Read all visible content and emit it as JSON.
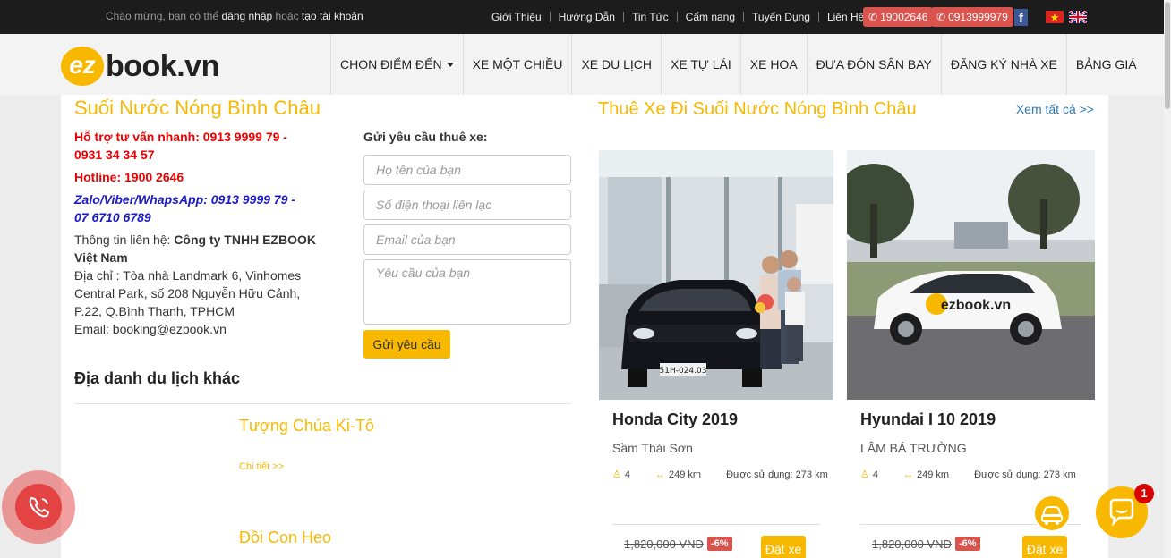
{
  "topbar": {
    "welcome_prefix": "Chào mừng, bạn có thể",
    "login": "đăng nhập",
    "or": "hoặc",
    "register": "tạo tài khoản",
    "links": [
      "Giới Thiệu",
      "Hướng Dẫn",
      "Tin Tức",
      "Cẩm nang",
      "Tuyển Dụng",
      "Liên Hệ"
    ],
    "phone1": "19002646",
    "phone2": "0913999979",
    "accent": "#d9534f"
  },
  "nav": {
    "logo_ez": "ez",
    "logo_book": "book.vn",
    "items": [
      "CHỌN ĐIỂM ĐẾN",
      "XE MỘT CHIỀU",
      "XE DU LỊCH",
      "XE TỰ LÁI",
      "XE HOA",
      "ĐƯA ĐÓN SÂN BAY",
      "ĐĂNG KÝ NHÀ XE",
      "BẢNG GIÁ"
    ]
  },
  "left": {
    "title": "Suối Nước Nóng Bình Châu",
    "support_line1": "Hỗ trợ tư vấn nhanh: 0913 9999 79 -",
    "support_line2": "0931 34 34 57",
    "hotline": "Hotline: 1900 2646",
    "zalo_line1": "Zalo/Viber/WhapsApp: 0913 9999 79 -",
    "zalo_line2": "07 6710 6789",
    "contact_label": "Thông tin liên hệ:",
    "company": "Công ty TNHH EZBOOK Việt Nam",
    "address": "Địa chỉ : Tòa nhà Landmark 6, Vinhomes Central Park, số 208 Nguyễn Hữu Cảnh, P.22, Q.Bình Thạnh, TPHCM",
    "email": "Email: booking@ezbook.vn",
    "form_title": "Gửi yêu cầu thuê xe:",
    "ph_name": "Họ tên của bạn",
    "ph_phone": "Số điện thoại liên lạc",
    "ph_email": "Email của bạn",
    "ph_request": "Yêu cầu của bạn",
    "submit": "Gửi yêu cầu",
    "other_title": "Địa danh du lịch khác",
    "places": [
      {
        "name": "Tượng Chúa Ki-Tô",
        "link": "Chi tiết >>"
      },
      {
        "name": "Đồi Con Heo"
      }
    ]
  },
  "right": {
    "title": "Thuê Xe Đi Suối Nước Nóng Bình Châu",
    "view_all": "Xem tất cả >>",
    "cars": [
      {
        "name": "Honda City 2019",
        "owner": "Sầm Thái Sơn",
        "seats": "4",
        "distance": "249 km",
        "used": "Được sử dụng: 273 km",
        "price": "1,820,000 VNĐ",
        "discount": "-6%",
        "book": "Đặt xe",
        "plate": "51H-024.03"
      },
      {
        "name": "Hyundai I 10 2019",
        "owner": "LÂM BÁ TRƯỜNG",
        "seats": "4",
        "distance": "249 km",
        "used": "Được sử dụng: 273 km",
        "price": "1,820,000 VNĐ",
        "discount": "-6%",
        "book": "Đặt xe",
        "brand": "ezbook.vn"
      }
    ]
  },
  "widgets": {
    "chat_badge": "1"
  }
}
